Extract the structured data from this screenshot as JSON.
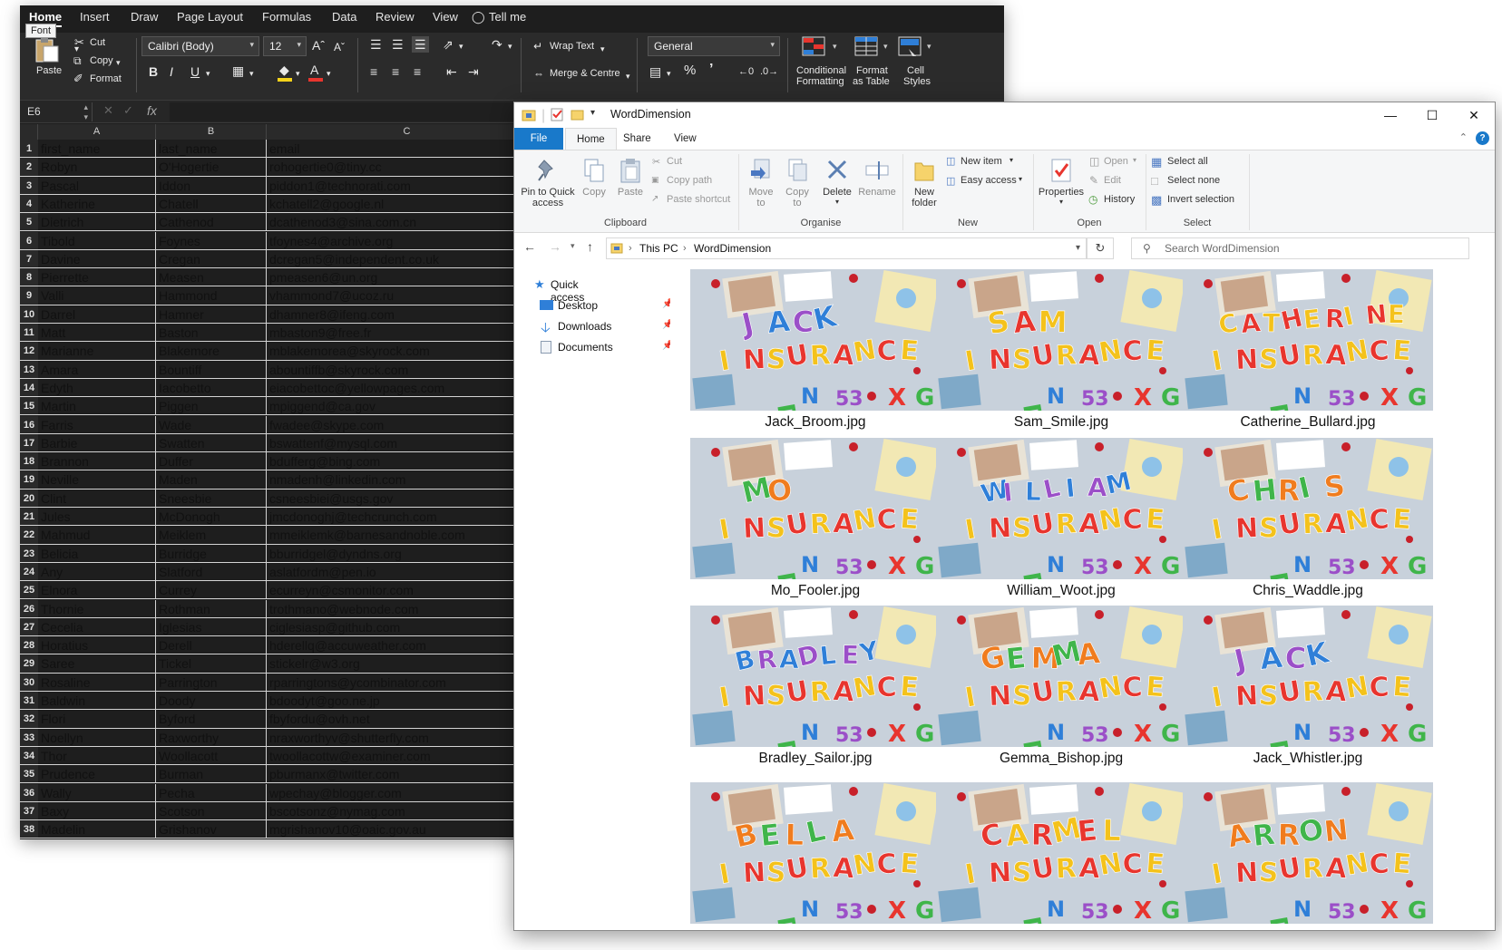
{
  "excel": {
    "tabs": [
      "Home",
      "Insert",
      "Draw",
      "Page Layout",
      "Formulas",
      "Data",
      "Review",
      "View",
      "Tell me"
    ],
    "font_tip": "Font",
    "paste_label": "Paste",
    "cut_label": "Cut",
    "copy_label": "Copy",
    "format_label": "Format",
    "font_name": "Calibri (Body)",
    "font_size": "12",
    "wrap_text_label": "Wrap Text",
    "merge_label": "Merge & Centre",
    "number_format": "General",
    "cond_format_label_1": "Conditional",
    "cond_format_label_2": "Formatting",
    "format_table_label_1": "Format",
    "format_table_label_2": "as Table",
    "cell_styles_label_1": "Cell",
    "cell_styles_label_2": "Styles",
    "name_box": "E6",
    "fx": "fx",
    "columns": [
      "A",
      "B",
      "C"
    ],
    "rows": [
      [
        "1",
        "first_name",
        "last_name",
        "email"
      ],
      [
        "2",
        "Robyn",
        "O'Hogertie",
        "rohogertie0@tiny.cc"
      ],
      [
        "3",
        "Pascal",
        "Iddon",
        "piddon1@technorati.com"
      ],
      [
        "4",
        "Katherine",
        "Chatell",
        "kchatell2@google.nl"
      ],
      [
        "5",
        "Dietrich",
        "Cathenod",
        "dcathenod3@sina.com.cn"
      ],
      [
        "6",
        "Tibold",
        "Foynes",
        "tfoynes4@archive.org"
      ],
      [
        "7",
        "Davine",
        "Cregan",
        "dcregan5@independent.co.uk"
      ],
      [
        "8",
        "Pierrette",
        "Measen",
        "pmeasen6@un.org"
      ],
      [
        "9",
        "Valli",
        "Hammond",
        "vhammond7@ucoz.ru"
      ],
      [
        "10",
        "Darrel",
        "Hamner",
        "dhamner8@ifeng.com"
      ],
      [
        "11",
        "Matt",
        "Baston",
        "mbaston9@free.fr"
      ],
      [
        "12",
        "Marianne",
        "Blakemore",
        "mblakemorea@skyrock.com"
      ],
      [
        "13",
        "Amara",
        "Bountiff",
        "abountiffb@skyrock.com"
      ],
      [
        "14",
        "Edyth",
        "Iacobetto",
        "eiacobettoc@yellowpages.com"
      ],
      [
        "15",
        "Martin",
        "Piggen",
        "mpiggend@ca.gov"
      ],
      [
        "16",
        "Farris",
        "Wade",
        "fwadee@skype.com"
      ],
      [
        "17",
        "Barbie",
        "Swatten",
        "bswattenf@mysql.com"
      ],
      [
        "18",
        "Brannon",
        "Duffer",
        "bdufferg@bing.com"
      ],
      [
        "19",
        "Neville",
        "Maden",
        "nmadenh@linkedin.com"
      ],
      [
        "20",
        "Clint",
        "Sneesbie",
        "csneesbiei@usgs.gov"
      ],
      [
        "21",
        "Jules",
        "McDonogh",
        "jmcdonoghj@techcrunch.com"
      ],
      [
        "22",
        "Mahmud",
        "Meiklem",
        "mmeiklemk@barnesandnoble.com"
      ],
      [
        "23",
        "Belicia",
        "Burridge",
        "bburridgel@dyndns.org"
      ],
      [
        "24",
        "Any",
        "Slatford",
        "aslatfordm@pen.io"
      ],
      [
        "25",
        "Elnora",
        "Currey",
        "ecurreyn@csmonitor.com"
      ],
      [
        "26",
        "Thornie",
        "Rothman",
        "trothmano@webnode.com"
      ],
      [
        "27",
        "Cecelia",
        "Iglesias",
        "ciglesiasp@github.com"
      ],
      [
        "28",
        "Horatius",
        "Derell",
        "hderellq@accuweather.com"
      ],
      [
        "29",
        "Saree",
        "Tickel",
        "stickelr@w3.org"
      ],
      [
        "30",
        "Rosaline",
        "Parrington",
        "rparringtons@ycombinator.com"
      ],
      [
        "31",
        "Baldwin",
        "Doody",
        "bdoodyt@goo.ne.jp"
      ],
      [
        "32",
        "Flori",
        "Byford",
        "fbyfordu@ovh.net"
      ],
      [
        "33",
        "Noellyn",
        "Raxworthy",
        "nraxworthyv@shutterfly.com"
      ],
      [
        "34",
        "Thor",
        "Woollacott",
        "twoollacottw@examiner.com"
      ],
      [
        "35",
        "Prudence",
        "Burman",
        "pburmanx@twitter.com"
      ],
      [
        "36",
        "Wally",
        "Pecha",
        "wpechay@blogger.com"
      ],
      [
        "37",
        "Baxy",
        "Scotson",
        "bscotsonz@nymag.com"
      ],
      [
        "38",
        "Madelin",
        "Grishanov",
        "mgrishanov10@oaic.gov.au"
      ]
    ]
  },
  "explorer": {
    "title": "WordDimension",
    "tabs": {
      "file": "File",
      "home": "Home",
      "share": "Share",
      "view": "View"
    },
    "ribbon": {
      "pin_1": "Pin to Quick",
      "pin_2": "access",
      "copy": "Copy",
      "paste": "Paste",
      "cut": "Cut",
      "copy_path": "Copy path",
      "paste_shortcut": "Paste shortcut",
      "move_to_1": "Move",
      "move_to_2": "to",
      "copy_to_1": "Copy",
      "copy_to_2": "to",
      "delete": "Delete",
      "rename": "Rename",
      "new_folder_1": "New",
      "new_folder_2": "folder",
      "new_item": "New item",
      "easy_access": "Easy access",
      "properties": "Properties",
      "open": "Open",
      "edit": "Edit",
      "history": "History",
      "select_all": "Select all",
      "select_none": "Select none",
      "invert_selection": "Invert selection",
      "groups": {
        "clipboard": "Clipboard",
        "organise": "Organise",
        "new": "New",
        "open": "Open",
        "select": "Select"
      }
    },
    "address": {
      "this_pc": "This PC",
      "folder": "WordDimension"
    },
    "search_placeholder": "Search WordDimension",
    "nav": {
      "quick_access": "Quick access",
      "desktop": "Desktop",
      "downloads": "Downloads",
      "documents": "Documents"
    },
    "files": [
      {
        "name": "Jack_Broom.jpg",
        "word": "JACK"
      },
      {
        "name": "Sam_Smile.jpg",
        "word": "SAM"
      },
      {
        "name": "Catherine_Bullard.jpg",
        "word": "CATHERINE"
      },
      {
        "name": "Mo_Fooler.jpg",
        "word": "MO"
      },
      {
        "name": "William_Woot.jpg",
        "word": "WILLIAM"
      },
      {
        "name": "Chris_Waddle.jpg",
        "word": "CHRIS"
      },
      {
        "name": "Bradley_Sailor.jpg",
        "word": "BRADLEY"
      },
      {
        "name": "Gemma_Bishop.jpg",
        "word": "GEMMA"
      },
      {
        "name": "Jack_Whistler.jpg",
        "word": "JACK"
      },
      {
        "name": "",
        "word": "BELLA"
      },
      {
        "name": "",
        "word": "CARMEL"
      },
      {
        "name": "",
        "word": "ARRON"
      }
    ],
    "thumb_word": "INSURANCE"
  },
  "colors": {
    "excel_bg": "#1e1e1e",
    "file_tab": "#1979ca",
    "letters": [
      "#e8352e",
      "#2f7fd8",
      "#3fb54a",
      "#f4c21b",
      "#9b4fc8",
      "#f07c1e"
    ]
  }
}
